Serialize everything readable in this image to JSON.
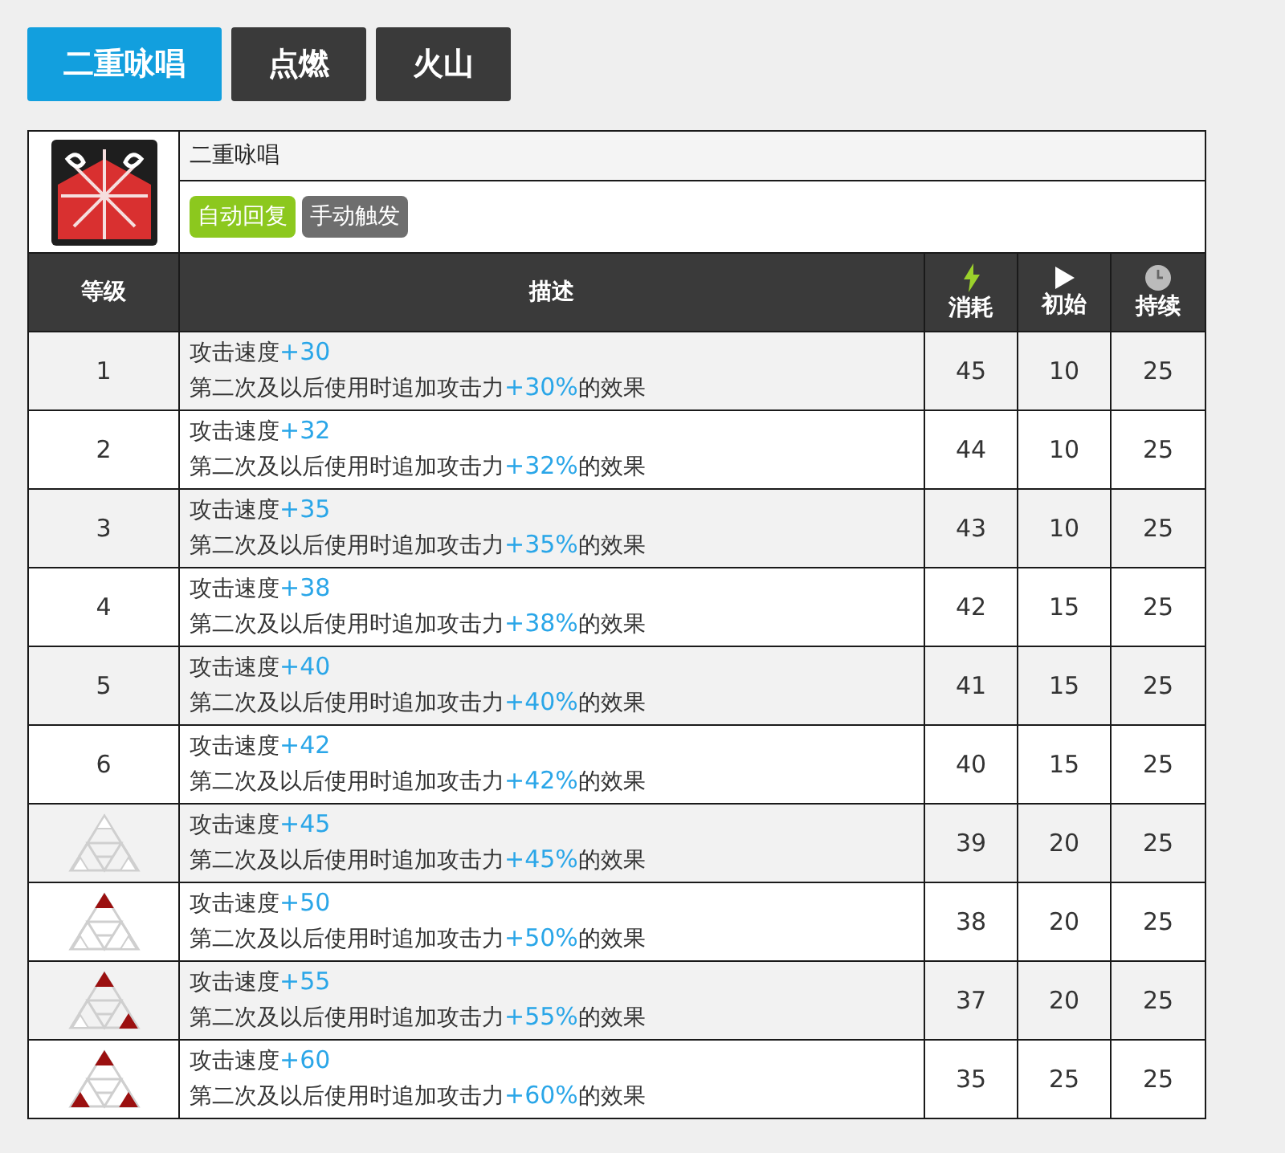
{
  "tabs": [
    {
      "label": "二重咏唱",
      "selected": true
    },
    {
      "label": "点燃",
      "selected": false
    },
    {
      "label": "火山",
      "selected": false
    }
  ],
  "skill": {
    "name": "二重咏唱",
    "tags": [
      {
        "label": "自动回复",
        "color": "#8cc81e"
      },
      {
        "label": "手动触发",
        "color": "#6e6e6e"
      }
    ]
  },
  "columns": [
    {
      "label": "等级",
      "kind": "plain"
    },
    {
      "label": "描述",
      "kind": "plain"
    },
    {
      "label": "消耗",
      "kind": "cost"
    },
    {
      "label": "初始",
      "kind": "initial"
    },
    {
      "label": "持续",
      "kind": "duration"
    }
  ],
  "rows": [
    {
      "level": {
        "kind": "number",
        "text": "1"
      },
      "stat": "攻击速度",
      "stat_bonus": "+30",
      "effect": "第二次及以后使用时追加攻击力",
      "effect_bonus": "+30%",
      "effect_end": "的效果",
      "cost": "45",
      "initial": "10",
      "duration": "25"
    },
    {
      "level": {
        "kind": "number",
        "text": "2"
      },
      "stat": "攻击速度",
      "stat_bonus": "+32",
      "effect": "第二次及以后使用时追加攻击力",
      "effect_bonus": "+32%",
      "effect_end": "的效果",
      "cost": "44",
      "initial": "10",
      "duration": "25"
    },
    {
      "level": {
        "kind": "number",
        "text": "3"
      },
      "stat": "攻击速度",
      "stat_bonus": "+35",
      "effect": "第二次及以后使用时追加攻击力",
      "effect_bonus": "+35%",
      "effect_end": "的效果",
      "cost": "43",
      "initial": "10",
      "duration": "25"
    },
    {
      "level": {
        "kind": "number",
        "text": "4"
      },
      "stat": "攻击速度",
      "stat_bonus": "+38",
      "effect": "第二次及以后使用时追加攻击力",
      "effect_bonus": "+38%",
      "effect_end": "的效果",
      "cost": "42",
      "initial": "15",
      "duration": "25"
    },
    {
      "level": {
        "kind": "number",
        "text": "5"
      },
      "stat": "攻击速度",
      "stat_bonus": "+40",
      "effect": "第二次及以后使用时追加攻击力",
      "effect_bonus": "+40%",
      "effect_end": "的效果",
      "cost": "41",
      "initial": "15",
      "duration": "25"
    },
    {
      "level": {
        "kind": "number",
        "text": "6"
      },
      "stat": "攻击速度",
      "stat_bonus": "+42",
      "effect": "第二次及以后使用时追加攻击力",
      "effect_bonus": "+42%",
      "effect_end": "的效果",
      "cost": "40",
      "initial": "15",
      "duration": "25"
    },
    {
      "level": {
        "kind": "rank",
        "pips": [
          {
            "filled": false
          },
          {
            "filled": false
          },
          {
            "filled": false
          }
        ]
      },
      "stat": "攻击速度",
      "stat_bonus": "+45",
      "effect": "第二次及以后使用时追加攻击力",
      "effect_bonus": "+45%",
      "effect_end": "的效果",
      "cost": "39",
      "initial": "20",
      "duration": "25"
    },
    {
      "level": {
        "kind": "rank",
        "pips": [
          {
            "filled": true
          },
          {
            "filled": false
          },
          {
            "filled": false
          }
        ]
      },
      "stat": "攻击速度",
      "stat_bonus": "+50",
      "effect": "第二次及以后使用时追加攻击力",
      "effect_bonus": "+50%",
      "effect_end": "的效果",
      "cost": "38",
      "initial": "20",
      "duration": "25"
    },
    {
      "level": {
        "kind": "rank",
        "pips": [
          {
            "filled": true
          },
          {
            "filled": true
          },
          {
            "filled": false
          }
        ]
      },
      "stat": "攻击速度",
      "stat_bonus": "+55",
      "effect": "第二次及以后使用时追加攻击力",
      "effect_bonus": "+55%",
      "effect_end": "的效果",
      "cost": "37",
      "initial": "20",
      "duration": "25"
    },
    {
      "level": {
        "kind": "rank",
        "pips": [
          {
            "filled": true
          },
          {
            "filled": true
          },
          {
            "filled": true
          }
        ]
      },
      "stat": "攻击速度",
      "stat_bonus": "+60",
      "effect": "第二次及以后使用时追加攻击力",
      "effect_bonus": "+60%",
      "effect_end": "的效果",
      "cost": "35",
      "initial": "25",
      "duration": "25"
    }
  ]
}
